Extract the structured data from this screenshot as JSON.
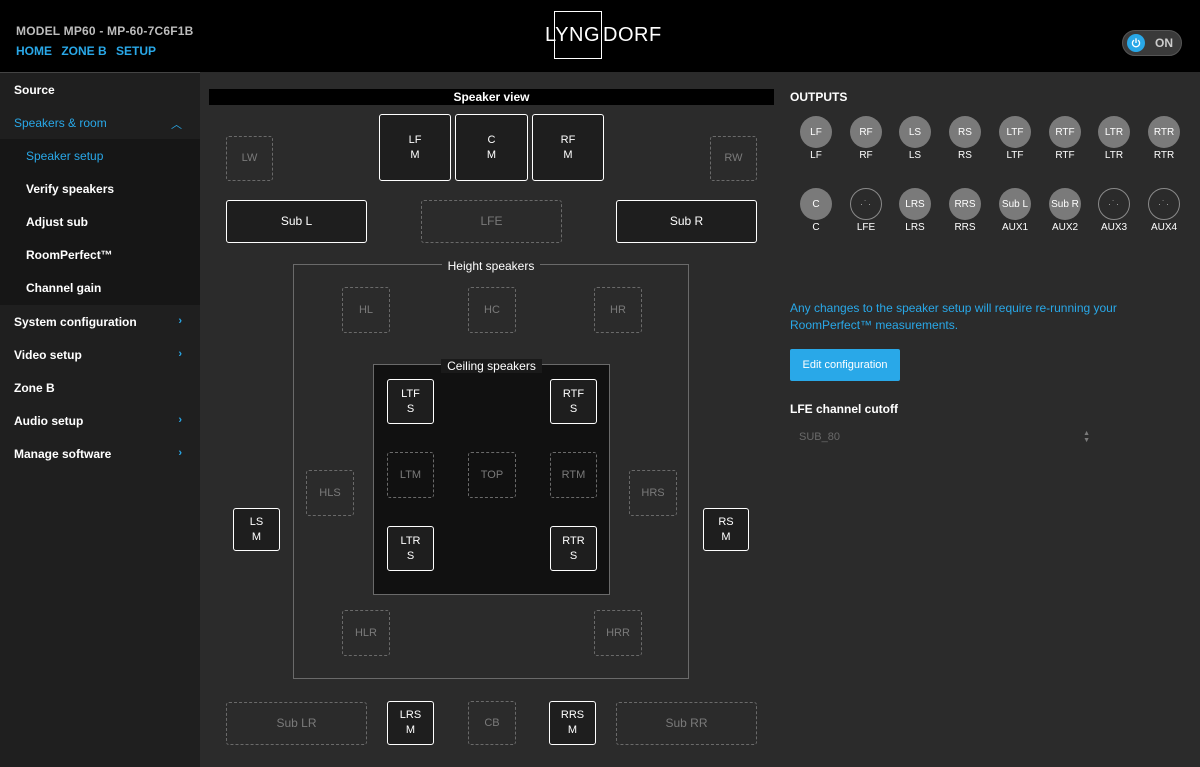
{
  "header": {
    "model": "MODEL MP60 - MP-60-7C6F1B",
    "crumbs": [
      "HOME",
      "ZONE B",
      "SETUP"
    ],
    "logo_box": "LYNG",
    "logo_rest": "DORF",
    "power_label": "ON"
  },
  "sidebar": {
    "items": [
      {
        "label": "Source"
      },
      {
        "label": "Speakers & room"
      },
      {
        "label": "Speaker setup"
      },
      {
        "label": "Verify speakers"
      },
      {
        "label": "Adjust sub"
      },
      {
        "label": "RoomPerfect™"
      },
      {
        "label": "Channel gain"
      },
      {
        "label": "System configuration"
      },
      {
        "label": "Video setup"
      },
      {
        "label": "Zone B"
      },
      {
        "label": "Audio setup"
      },
      {
        "label": "Manage software"
      }
    ]
  },
  "speaker_view": {
    "title": "Speaker view",
    "height_label": "Height speakers",
    "ceiling_label": "Ceiling speakers",
    "speakers": {
      "LW": {
        "name": "LW",
        "mode": ""
      },
      "LF": {
        "name": "LF",
        "mode": "M"
      },
      "C": {
        "name": "C",
        "mode": "M"
      },
      "RF": {
        "name": "RF",
        "mode": "M"
      },
      "RW": {
        "name": "RW",
        "mode": ""
      },
      "SubL": {
        "name": "Sub L",
        "mode": ""
      },
      "LFE": {
        "name": "LFE",
        "mode": ""
      },
      "SubR": {
        "name": "Sub R",
        "mode": ""
      },
      "HL": {
        "name": "HL",
        "mode": ""
      },
      "HC": {
        "name": "HC",
        "mode": ""
      },
      "HR": {
        "name": "HR",
        "mode": ""
      },
      "LTF": {
        "name": "LTF",
        "mode": "S"
      },
      "RTF": {
        "name": "RTF",
        "mode": "S"
      },
      "LTM": {
        "name": "LTM",
        "mode": ""
      },
      "TOP": {
        "name": "TOP",
        "mode": ""
      },
      "RTM": {
        "name": "RTM",
        "mode": ""
      },
      "HLS": {
        "name": "HLS",
        "mode": ""
      },
      "HRS": {
        "name": "HRS",
        "mode": ""
      },
      "LS": {
        "name": "LS",
        "mode": "M"
      },
      "RS": {
        "name": "RS",
        "mode": "M"
      },
      "LTR": {
        "name": "LTR",
        "mode": "S"
      },
      "RTR": {
        "name": "RTR",
        "mode": "S"
      },
      "HLR": {
        "name": "HLR",
        "mode": ""
      },
      "HRR": {
        "name": "HRR",
        "mode": ""
      },
      "SubLR": {
        "name": "Sub LR",
        "mode": ""
      },
      "LRS": {
        "name": "LRS",
        "mode": "M"
      },
      "CB": {
        "name": "CB",
        "mode": ""
      },
      "RRS": {
        "name": "RRS",
        "mode": "M"
      },
      "SubRR": {
        "name": "Sub RR",
        "mode": ""
      }
    }
  },
  "outputs": {
    "title": "OUTPUTS",
    "row1": [
      {
        "badge": "LF",
        "name": "LF"
      },
      {
        "badge": "RF",
        "name": "RF"
      },
      {
        "badge": "LS",
        "name": "LS"
      },
      {
        "badge": "RS",
        "name": "RS"
      },
      {
        "badge": "LTF",
        "name": "LTF"
      },
      {
        "badge": "RTF",
        "name": "RTF"
      },
      {
        "badge": "LTR",
        "name": "LTR"
      },
      {
        "badge": "RTR",
        "name": "RTR"
      }
    ],
    "row2": [
      {
        "badge": "C",
        "name": "C"
      },
      {
        "badge": "",
        "name": "LFE"
      },
      {
        "badge": "LRS",
        "name": "LRS"
      },
      {
        "badge": "RRS",
        "name": "RRS"
      },
      {
        "badge": "Sub L",
        "name": "AUX1"
      },
      {
        "badge": "Sub R",
        "name": "AUX2"
      },
      {
        "badge": "",
        "name": "AUX3"
      },
      {
        "badge": "",
        "name": "AUX4"
      }
    ]
  },
  "notice": "Any changes to the speaker setup will require re-running your RoomPerfect™ measurements.",
  "edit_button": "Edit configuration",
  "lfe": {
    "title": "LFE channel cutoff",
    "value": "SUB_80"
  },
  "colors": {
    "accent": "#29a8e8",
    "background": "#2b2b2b",
    "header": "#000000"
  }
}
